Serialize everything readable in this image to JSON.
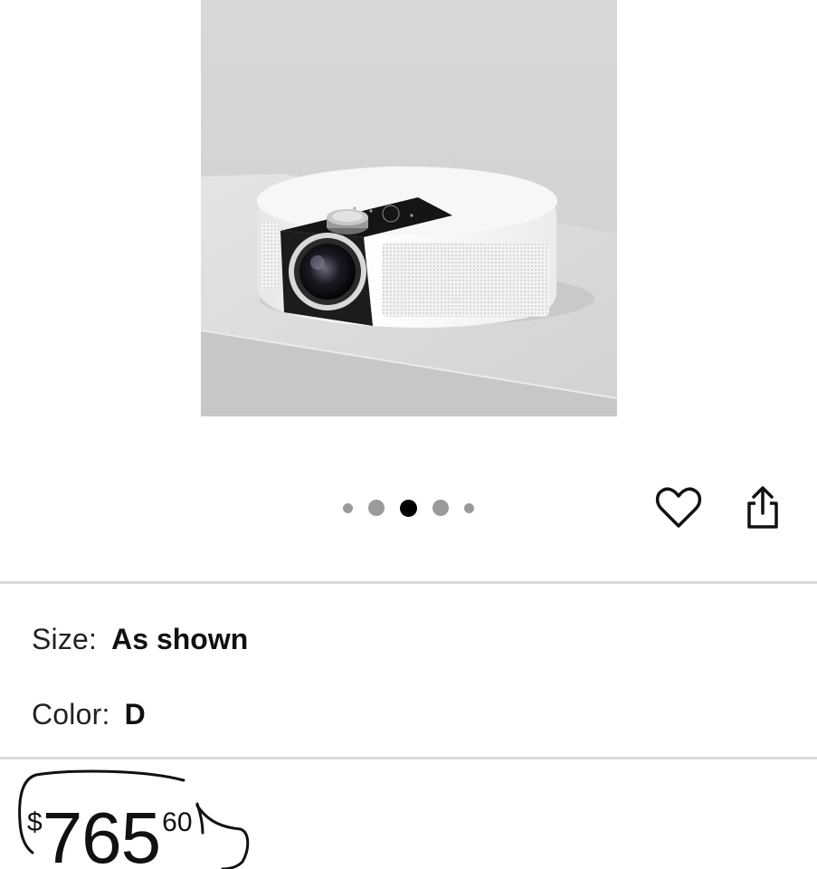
{
  "product": {
    "image_alt": "White round projector with black lens panel"
  },
  "carousel": {
    "total": 5,
    "active_index": 2
  },
  "actions": {
    "favorite_icon": "heart-icon",
    "share_icon": "share-icon"
  },
  "options": {
    "size_label": "Size:",
    "size_value": "As shown",
    "color_label": "Color:",
    "color_value": "D"
  },
  "price": {
    "currency": "$",
    "whole": "765",
    "fraction": "60"
  },
  "colors": {
    "accent": "#000000",
    "dot_inactive": "#9a9a9a",
    "divider": "#dadada"
  }
}
